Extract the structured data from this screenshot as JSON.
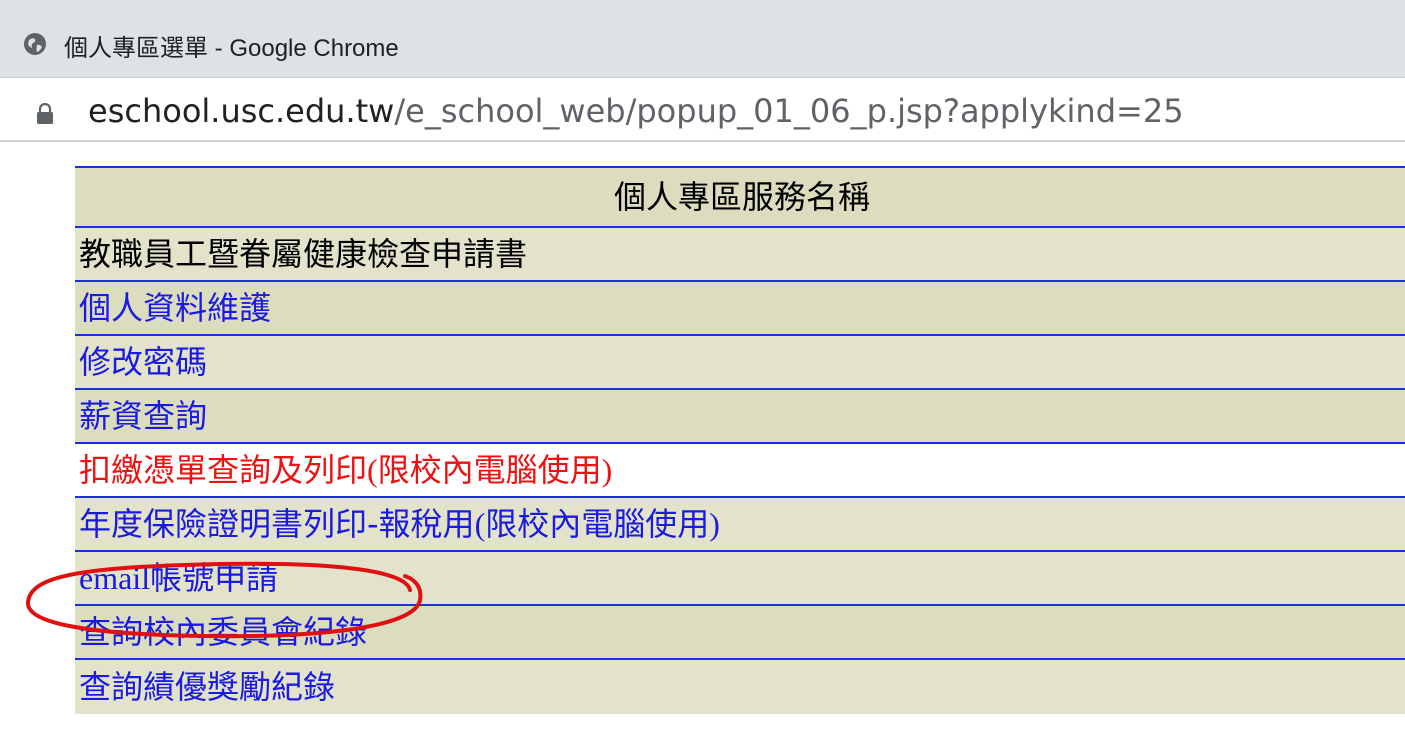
{
  "window": {
    "title": "個人專區選單 - Google Chrome",
    "icon": "globe-icon"
  },
  "address_bar": {
    "host": "eschool.usc.edu.tw",
    "path": "/e_school_web/popup_01_06_p.jsp?applykind=25",
    "icon": "lock-icon"
  },
  "menu": {
    "header": "個人專區服務名稱",
    "items": [
      {
        "label": "教職員工暨眷屬健康檢查申請書",
        "color": "#000000"
      },
      {
        "label": "個人資料維護",
        "color": "#1a1ae0"
      },
      {
        "label": "修改密碼",
        "color": "#1a1ae0"
      },
      {
        "label": "薪資查詢",
        "color": "#1a1ae0"
      },
      {
        "label_prefix": "扣繳憑單查詢及列印",
        "label_suffix": "(限校內電腦使用)",
        "color": "#ee1111"
      },
      {
        "label_prefix": "年度保險證明書列印-報稅用",
        "label_suffix": "(限校內電腦使用)",
        "color": "#1a1ae0"
      },
      {
        "label_prefix": "email",
        "label_suffix": "帳號申請",
        "color": "#1a1ae0"
      },
      {
        "label": "查詢校內委員會紀錄",
        "color": "#1a1ae0"
      },
      {
        "label": "查詢績優獎勵紀錄",
        "color": "#1a1ae0"
      }
    ]
  },
  "colors": {
    "border": "#1f2ee0",
    "row_dark": "#dcdcbf",
    "row_light": "#e3e3cc",
    "annotation": "#e01010"
  }
}
